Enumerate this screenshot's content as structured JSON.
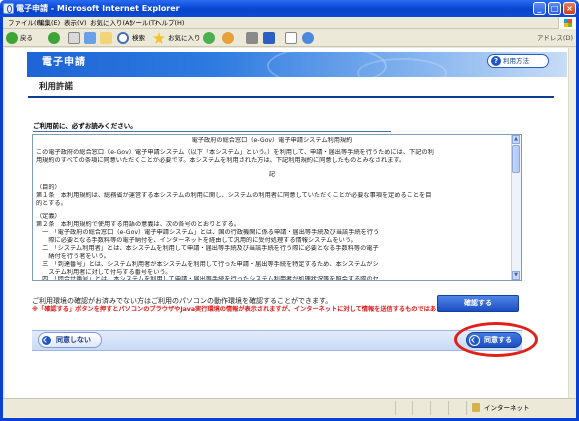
{
  "window": {
    "title": "電子申請 - Microsoft Internet Explorer",
    "controls": {
      "minimize": "_",
      "maximize": "□",
      "close": "×"
    }
  },
  "menubar": {
    "items": [
      "ファイル(F)",
      "編集(E)",
      "表示(V)",
      "お気に入り(A)",
      "ツール(T)",
      "ヘルプ(H)"
    ]
  },
  "toolbar": {
    "back": "戻る",
    "search": "検索",
    "favorites": "お気に入り",
    "address_label": "アドレス(D)"
  },
  "page": {
    "site_title": "電子申請",
    "help_button": "利用方法",
    "section_title": "利用許諾",
    "notice": "ご利用前に、必ずお読みください。",
    "terms": {
      "heading": "電子政府の総合窓口（e-Gov）電子申請システム利用規約",
      "intro": [
        "この電子政府の総合窓口（e-Gov）電子申請システム（以下「本システム」という。）を利用して、申請・届出等手続を行うためには、下記の利",
        "用規約のすべての条項に同意いただくことが必要です。本システムを利用された方は、下記利用規約に同意したものとみなされます。"
      ],
      "ki": "記",
      "purpose_heading": "（目的）",
      "purpose": [
        "第１条　本利用規約は、総務省が運営する本システムの利用に関し、システムの利用者に同意していただくことが必要な事項を定めることを目",
        "的とする。"
      ],
      "def_heading": "（定義）",
      "defs": [
        "第２条　本利用規約で使用する用語の意義は、次の各号のとおりとする。",
        "　一　「電子政府の総合窓口（e-Gov）電子申請システム」とは、国の行政機関に係る申請・届出等手続及び当該手続を行う",
        "　　際に必要となる手数料等の電子納付を、インターネットを経由して汎用的に受付処理する情報システムをいう。",
        "　二　「システム利用者」とは、本システムを利用して申請・届出等手続及び当該手続を行う際に必要となる手数料等の電子",
        "　　納付を行う者をいう。",
        "　三　「到達番号」とは、システム利用者が本システムを利用して行った申請・届出等手続を特定するため、本システムがシ",
        "　　ステム利用者に対して付与する番号をいう。",
        "　四　「問合せ番号」とは、本システムを利用して申請・届出等手続を行ったシステム利用者が処理状況等を照会する際のセ"
      ]
    },
    "env_text": "ご利用環境の確認がお済みでない方はご利用のパソコンの動作環境を確認することができます。",
    "warning": "※「確認する」ボタンを押すとパソコンのブラウザやJava実行環境の情報が表示されますが、インターネットに対して情報を送信するものではありません。",
    "check_button": "確認する",
    "disagree_button": "同意しない",
    "agree_button": "同意する"
  },
  "statusbar": {
    "zone": "インターネット"
  },
  "colors": {
    "titlebar": "#0b4ad6",
    "accent": "#1e56c8",
    "warning": "#e11919",
    "highlight_ring": "#e0201a"
  }
}
